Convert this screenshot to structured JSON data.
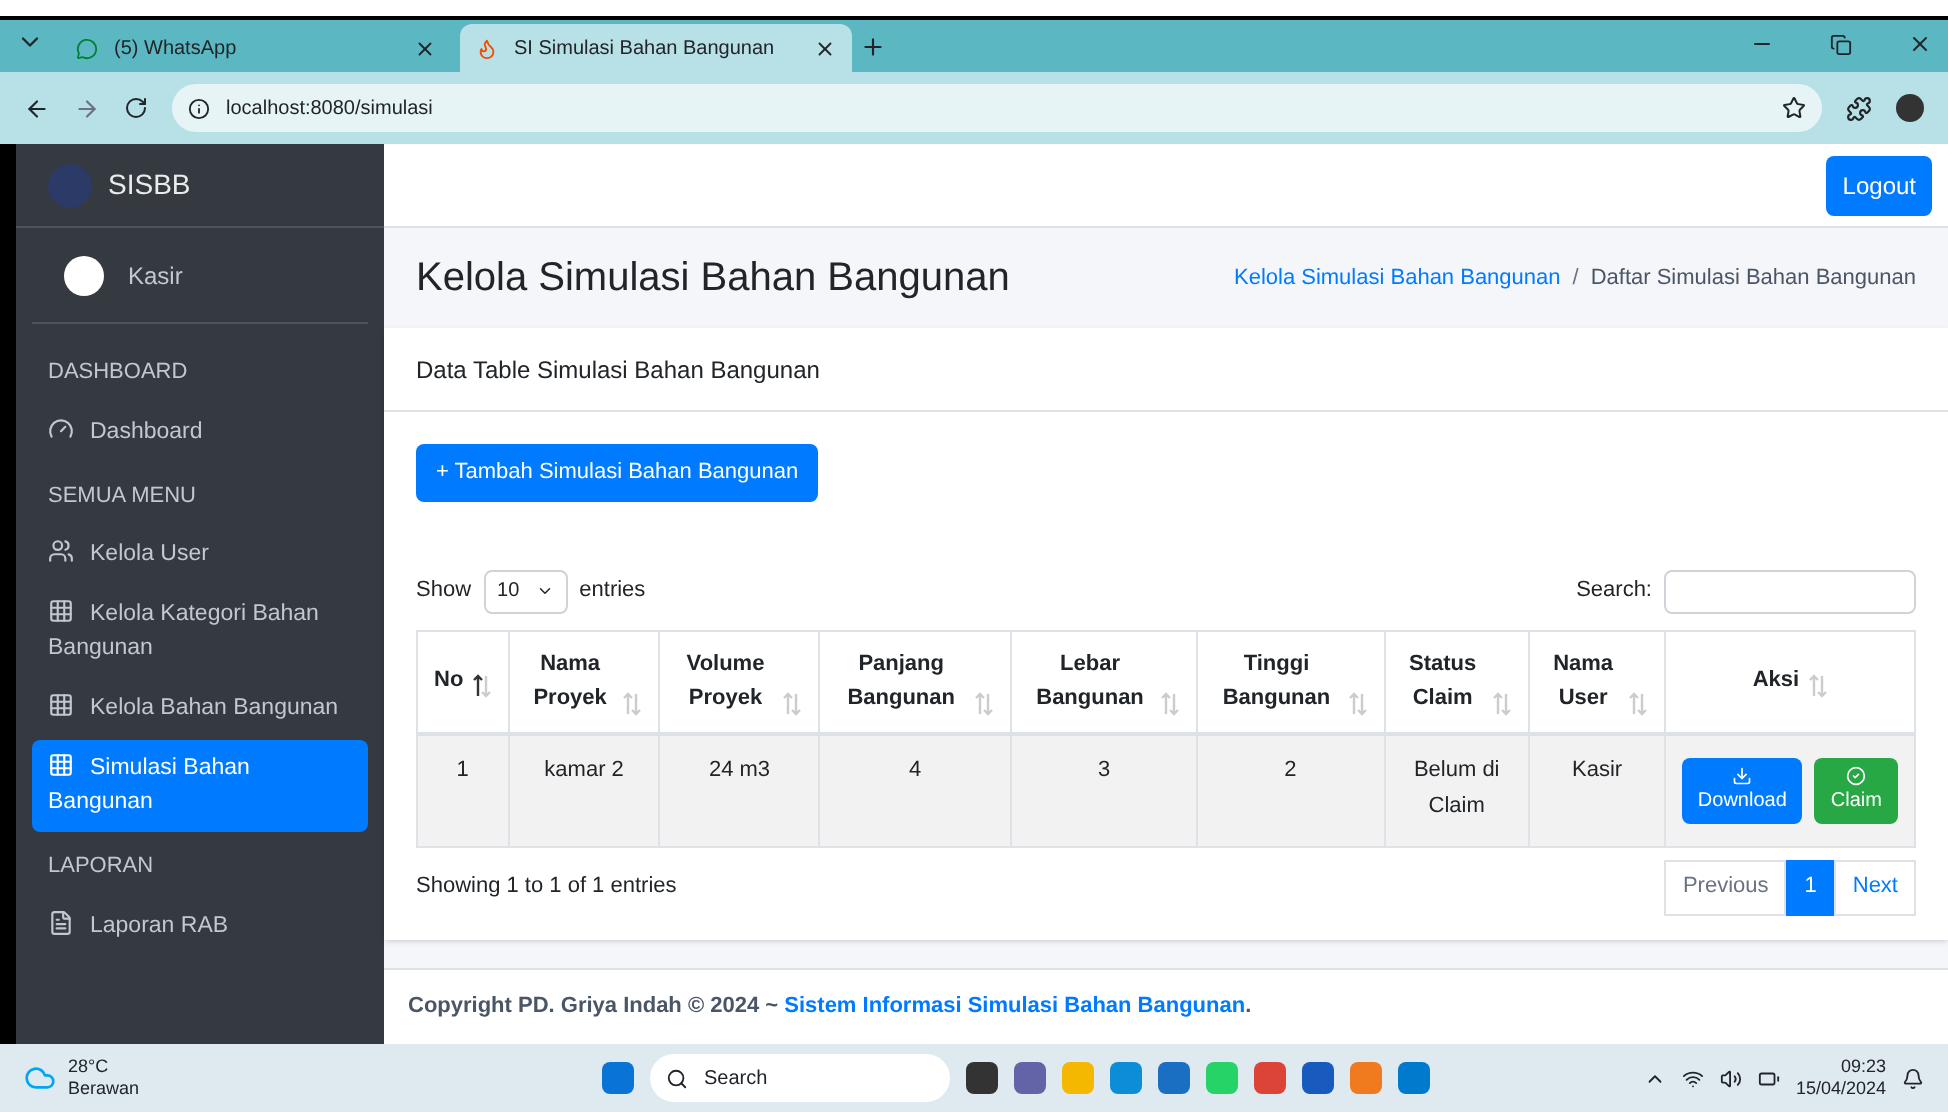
{
  "browser": {
    "tabs": [
      {
        "label": "(5) WhatsApp",
        "selected": false
      },
      {
        "label": "SI Simulasi Bahan Bangunan",
        "selected": true
      }
    ],
    "url": "localhost:8080/simulasi"
  },
  "sidebar": {
    "brand": "SISBB",
    "user": "Kasir",
    "sections": [
      {
        "heading": "DASHBOARD",
        "items": [
          {
            "label": "Dashboard",
            "kind": "gauge",
            "selected": false
          }
        ]
      },
      {
        "heading": "SEMUA MENU",
        "items": [
          {
            "label": "Kelola User",
            "kind": "users",
            "selected": false
          },
          {
            "label": "Kelola Kategori Bahan Bangunan",
            "kind": "grid",
            "selected": false
          },
          {
            "label": "Kelola Bahan Bangunan",
            "kind": "grid",
            "selected": false
          },
          {
            "label": "Simulasi Bahan Bangunan",
            "kind": "grid",
            "selected": true
          }
        ]
      },
      {
        "heading": "LAPORAN",
        "items": [
          {
            "label": "Laporan RAB",
            "kind": "file",
            "selected": false
          }
        ]
      }
    ]
  },
  "navbar": {
    "logout": "Logout"
  },
  "page": {
    "title": "Kelola Simulasi Bahan Bangunan",
    "breadcrumb": [
      {
        "label": "Kelola Simulasi Bahan Bangunan",
        "kind": "link"
      },
      {
        "label": "Daftar Simulasi Bahan Bangunan",
        "kind": "current"
      }
    ],
    "separator": "/"
  },
  "card": {
    "title": "Data Table Simulasi Bahan Bangunan",
    "add_button": "+ Tambah Simulasi Bahan Bangunan",
    "show": "Show",
    "page_size": "10",
    "entries": "entries",
    "search_label": "Search:",
    "table": {
      "columns": [
        {
          "label": "No",
          "sorted": true
        },
        {
          "label": "Nama Proyek",
          "sorted": false
        },
        {
          "label": "Volume Proyek",
          "sorted": false
        },
        {
          "label": "Panjang Bangunan",
          "sorted": false
        },
        {
          "label": "Lebar Bangunan",
          "sorted": false
        },
        {
          "label": "Tinggi Bangunan",
          "sorted": false
        },
        {
          "label": "Status Claim",
          "sorted": false
        },
        {
          "label": "Nama User",
          "sorted": false
        },
        {
          "label": "Aksi",
          "sorted": false
        }
      ],
      "rows": [
        {
          "cells": [
            "1",
            "kamar 2",
            "24 m3",
            "4",
            "3",
            "2",
            "Belum di Claim",
            "Kasir"
          ],
          "actions": [
            {
              "label": "Download",
              "kind": "download"
            },
            {
              "label": "Claim",
              "kind": "claim"
            }
          ]
        }
      ]
    },
    "info": "Showing 1 to 1 of 1 entries",
    "pagination": [
      {
        "label": "Previous",
        "selected": false,
        "disabled": true
      },
      {
        "label": "1",
        "selected": true,
        "disabled": false
      },
      {
        "label": "Next",
        "selected": false,
        "disabled": false
      }
    ]
  },
  "footer": {
    "text": "Copyright PD. Griya Indah © 2024 ~ ",
    "link": "Sistem Informasi Simulasi Bahan Bangunan",
    "end": "."
  },
  "taskbar": {
    "temperature": "28°C",
    "weather": "Berawan",
    "search": "Search",
    "time": "09:23",
    "date": "15/04/2024"
  }
}
